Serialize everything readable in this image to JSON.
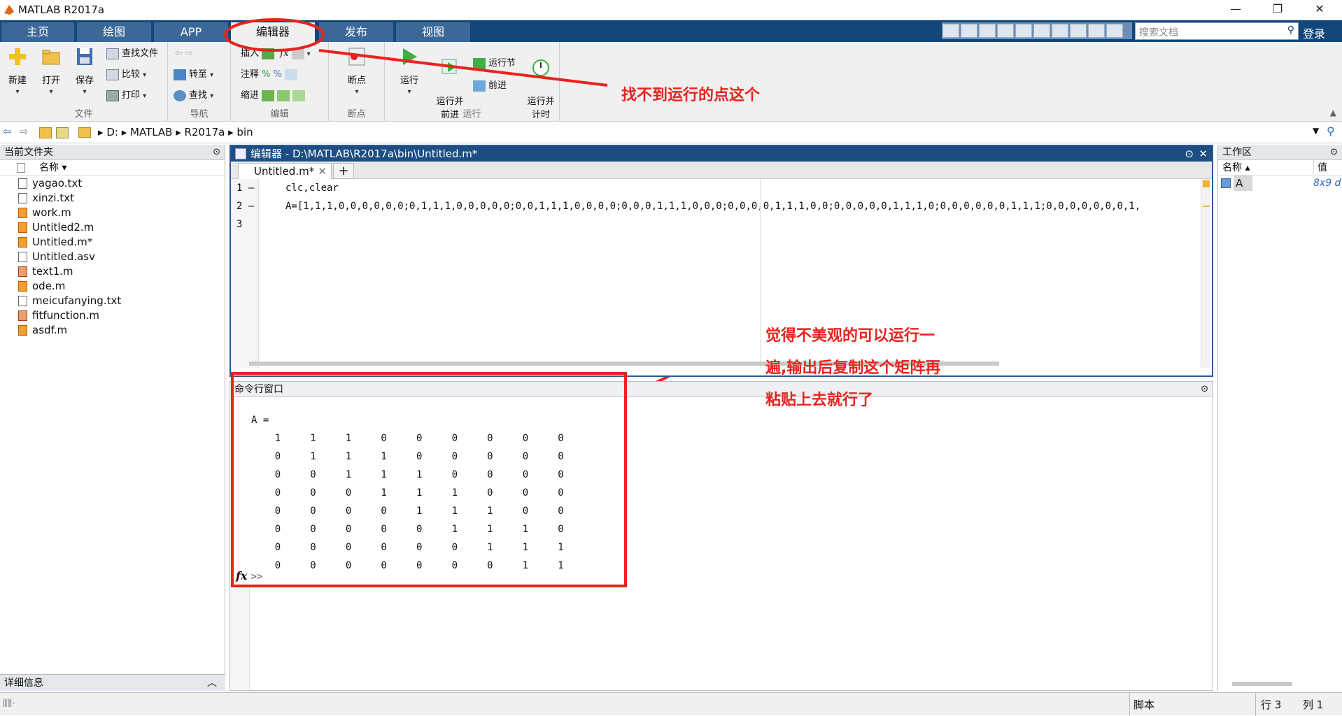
{
  "window": {
    "title": "MATLAB R2017a",
    "controls": [
      "—",
      "❐",
      "✕"
    ]
  },
  "tabs": [
    {
      "label": "主页"
    },
    {
      "label": "绘图"
    },
    {
      "label": "APP"
    },
    {
      "label": "编辑器"
    },
    {
      "label": "发布"
    },
    {
      "label": "视图"
    }
  ],
  "search": {
    "placeholder": "搜索文档"
  },
  "login": "登录",
  "ribbon": {
    "file": {
      "new": "新建",
      "open": "打开",
      "save": "保存",
      "find_files": "查找文件",
      "compare": "比较",
      "print": "打印",
      "label": "文件"
    },
    "nav": {
      "goto": "转至",
      "find": "查找",
      "label": "导航"
    },
    "edit": {
      "insert": "插入",
      "comment": "注释",
      "indent": "缩进",
      "label": "编辑"
    },
    "breakpoints": {
      "breakpoints": "断点",
      "label": "断点"
    },
    "run": {
      "run": "运行",
      "run_advance": "运行并\n前进",
      "run_section": "运行节",
      "advance": "前进",
      "run_time": "运行并\n计时",
      "label": "运行"
    }
  },
  "address": {
    "parts": [
      "D:",
      "MATLAB",
      "R2017a",
      "bin"
    ]
  },
  "current_folder": {
    "title": "当前文件夹",
    "name_col": "名称 ▾",
    "files": [
      {
        "name": "yagao.txt",
        "type": "txt"
      },
      {
        "name": "xinzi.txt",
        "type": "txt"
      },
      {
        "name": "work.m",
        "type": "m"
      },
      {
        "name": "Untitled2.m",
        "type": "m"
      },
      {
        "name": "Untitled.m*",
        "type": "m"
      },
      {
        "name": "Untitled.asv",
        "type": "txt"
      },
      {
        "name": "text1.m",
        "type": "f"
      },
      {
        "name": "ode.m",
        "type": "m"
      },
      {
        "name": "meicufanying.txt",
        "type": "txt"
      },
      {
        "name": "fitfunction.m",
        "type": "f"
      },
      {
        "name": "asdf.m",
        "type": "m"
      }
    ],
    "details": "详细信息"
  },
  "editor": {
    "title": "编辑器 - D:\\MATLAB\\R2017a\\bin\\Untitled.m*",
    "tab": "Untitled.m*",
    "add_tab": "+",
    "lines": [
      "1 —",
      "2 —",
      "3"
    ],
    "code": [
      "clc,clear",
      "A=[1,1,1,0,0,0,0,0,0;0,1,1,1,0,0,0,0,0;0,0,1,1,1,0,0,0,0;0,0,0,1,1,1,0,0,0;0,0,0,0,1,1,1,0,0;0,0,0,0,0,1,1,1,0;0,0,0,0,0,0,1,1,1;0,0,0,0,0,0,0,1,",
      ""
    ]
  },
  "command_window": {
    "title": "命令行窗口",
    "header": "A =",
    "rows": [
      "    1     1     1     0     0     0     0     0     0",
      "    0     1     1     1     0     0     0     0     0",
      "    0     0     1     1     1     0     0     0     0",
      "    0     0     0     1     1     1     0     0     0",
      "    0     0     0     0     1     1     1     0     0",
      "    0     0     0     0     0     1     1     1     0",
      "    0     0     0     0     0     0     1     1     1",
      "    0     0     0     0     0     0     0     1     1"
    ],
    "prompt_fx": "fx",
    "prompt": ">>"
  },
  "workspace": {
    "title": "工作区",
    "name_col": "名称 ▴",
    "value_col": "值",
    "var_name": "A",
    "var_value": "8x9 d"
  },
  "status": {
    "mode": "脚本",
    "row_label": "行",
    "row": "3",
    "col_label": "列",
    "col": "1"
  },
  "annotations": {
    "arrow_text": "找不到运行的点这个",
    "note_lines": [
      "觉得不美观的可以运行一",
      "遍,输出后复制这个矩阵再",
      "粘贴上去就行了"
    ]
  },
  "colors": {
    "accent": "#13477a",
    "annotation": "#e8231f"
  }
}
